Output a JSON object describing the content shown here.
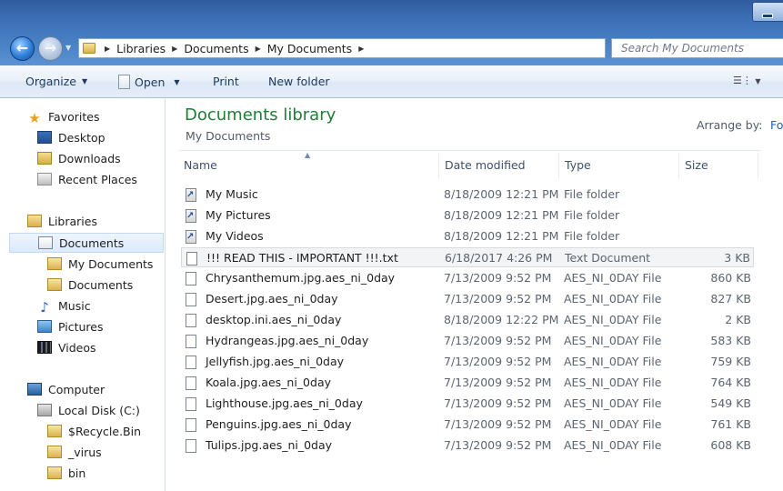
{
  "address": {
    "crumbs": [
      "Libraries",
      "Documents",
      "My Documents"
    ]
  },
  "search": {
    "placeholder": "Search My Documents"
  },
  "toolbar": {
    "organize": "Organize",
    "open": "Open",
    "print": "Print",
    "new_folder": "New folder"
  },
  "nav": {
    "favorites": "Favorites",
    "desktop": "Desktop",
    "downloads": "Downloads",
    "recent_places": "Recent Places",
    "libraries": "Libraries",
    "documents": "Documents",
    "my_documents": "My Documents",
    "public_documents": "Documents",
    "music": "Music",
    "pictures": "Pictures",
    "videos": "Videos",
    "computer": "Computer",
    "local_disk": "Local Disk (C:)",
    "recycle_bin": "$Recycle.Bin",
    "virus": "_virus",
    "bin": "bin"
  },
  "library": {
    "title": "Documents library",
    "subtitle": "My Documents",
    "arrange_label": "Arrange by:",
    "arrange_value": "Fo"
  },
  "columns": {
    "name": "Name",
    "date": "Date modified",
    "type": "Type",
    "size": "Size"
  },
  "files": [
    {
      "name": "My Music",
      "date": "8/18/2009 12:21 PM",
      "type": "File folder",
      "size": "",
      "icon": "shortcut-icon"
    },
    {
      "name": "My Pictures",
      "date": "8/18/2009 12:21 PM",
      "type": "File folder",
      "size": "",
      "icon": "shortcut-icon"
    },
    {
      "name": "My Videos",
      "date": "8/18/2009 12:21 PM",
      "type": "File folder",
      "size": "",
      "icon": "shortcut-icon"
    },
    {
      "name": "!!! READ THIS - IMPORTANT !!!.txt",
      "date": "6/18/2017 4:26 PM",
      "type": "Text Document",
      "size": "3 KB",
      "icon": "text-file-icon"
    },
    {
      "name": "Chrysanthemum.jpg.aes_ni_0day",
      "date": "7/13/2009 9:52 PM",
      "type": "AES_NI_0DAY File",
      "size": "860 KB",
      "icon": "file-icon"
    },
    {
      "name": "Desert.jpg.aes_ni_0day",
      "date": "7/13/2009 9:52 PM",
      "type": "AES_NI_0DAY File",
      "size": "827 KB",
      "icon": "file-icon"
    },
    {
      "name": "desktop.ini.aes_ni_0day",
      "date": "8/18/2009 12:22 PM",
      "type": "AES_NI_0DAY File",
      "size": "2 KB",
      "icon": "file-icon"
    },
    {
      "name": "Hydrangeas.jpg.aes_ni_0day",
      "date": "7/13/2009 9:52 PM",
      "type": "AES_NI_0DAY File",
      "size": "583 KB",
      "icon": "file-icon"
    },
    {
      "name": "Jellyfish.jpg.aes_ni_0day",
      "date": "7/13/2009 9:52 PM",
      "type": "AES_NI_0DAY File",
      "size": "759 KB",
      "icon": "file-icon"
    },
    {
      "name": "Koala.jpg.aes_ni_0day",
      "date": "7/13/2009 9:52 PM",
      "type": "AES_NI_0DAY File",
      "size": "764 KB",
      "icon": "file-icon"
    },
    {
      "name": "Lighthouse.jpg.aes_ni_0day",
      "date": "7/13/2009 9:52 PM",
      "type": "AES_NI_0DAY File",
      "size": "549 KB",
      "icon": "file-icon"
    },
    {
      "name": "Penguins.jpg.aes_ni_0day",
      "date": "7/13/2009 9:52 PM",
      "type": "AES_NI_0DAY File",
      "size": "761 KB",
      "icon": "file-icon"
    },
    {
      "name": "Tulips.jpg.aes_ni_0day",
      "date": "7/13/2009 9:52 PM",
      "type": "AES_NI_0DAY File",
      "size": "608 KB",
      "icon": "file-icon"
    }
  ],
  "selected_row": 3,
  "colors": {
    "title_green": "#1e7e34",
    "chrome_blue": "#3c70b6",
    "link_blue": "#1a5fb4"
  }
}
